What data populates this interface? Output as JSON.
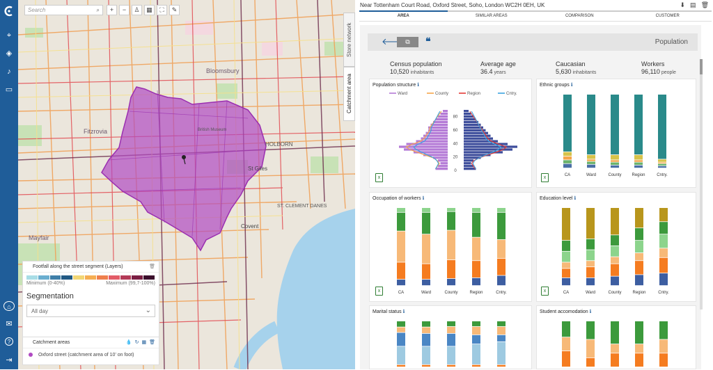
{
  "search": {
    "placeholder": "Search"
  },
  "map_labels": {
    "bloomsbury": "Bloomsbury",
    "fitzrovia": "Fitzrovia",
    "holborn": "HOLBORN",
    "st_giles": "St Giles",
    "british_museum": "British Museum",
    "clement_danes": "ST. CLEMENT DANES",
    "covent": "Covent",
    "mayfair": "Mayfair"
  },
  "side_tabs": {
    "store_network": "Store network",
    "catchment_area": "Catchment area"
  },
  "layers": {
    "title": "Footfall along the street segment (Layers)",
    "ramp_colors": [
      "#a8dde6",
      "#6aaecf",
      "#3f7fa8",
      "#225a84",
      "#f2d675",
      "#f5ae52",
      "#ef7f4d",
      "#e25c67",
      "#b33a57",
      "#7a1f43",
      "#3b0f2c"
    ],
    "min_label": "Minimum (0-40%)",
    "max_label": "Maximum (99,7-100%)"
  },
  "segmentation": {
    "title": "Segmentation",
    "value": "All day"
  },
  "catchment": {
    "title": "Catchment areas",
    "item": "Oxford street (catchment area of 10' on foot)"
  },
  "header": {
    "address": "Near Tottenham Court Road, Oxford Street, Soho, London WC2H 0EH, UK"
  },
  "tabs": [
    "AREA",
    "SIMILAR AREAS",
    "COMPARISON",
    "CUSTOMER"
  ],
  "section_title": "Population",
  "stats": [
    {
      "label": "Census population",
      "value": "10,520",
      "unit": "inhabitants"
    },
    {
      "label": "Average age",
      "value": "36.4",
      "unit": "years"
    },
    {
      "label": "Caucasian",
      "value": "5,630",
      "unit": "inhabitants"
    },
    {
      "label": "Workers",
      "value": "96,110",
      "unit": "people"
    }
  ],
  "cards": {
    "population_structure": "Population structure",
    "ethnic_groups": "Ethnic groups",
    "occupation": "Occupation of workers",
    "education": "Education level",
    "marital": "Marital status",
    "student": "Student accomodation"
  },
  "pyramid_legend": [
    "Ward",
    "County",
    "Region",
    "Cntry."
  ],
  "pyramid_legend_colors": [
    "#b47ad6",
    "#f5a54a",
    "#e53935",
    "#3aa3e0"
  ],
  "age_ticks": [
    "80",
    "60",
    "40",
    "20",
    "0"
  ],
  "bar_categories": [
    "CA",
    "Ward",
    "County",
    "Region",
    "Cntry."
  ],
  "colors": {
    "purple": "#a35bd3",
    "navy": "#3d4d9b",
    "teal": "#2b8c8c"
  },
  "chart_data": [
    {
      "type": "bar",
      "title": "Ethnic groups",
      "categories": [
        "CA",
        "Ward",
        "County",
        "Region",
        "Cntry."
      ],
      "series": [
        {
          "color": "#4a6fa5",
          "values": [
            6,
            5,
            4,
            4,
            3
          ]
        },
        {
          "color": "#6bb36b",
          "values": [
            5,
            4,
            4,
            4,
            3
          ]
        },
        {
          "color": "#f5a54a",
          "values": [
            5,
            3,
            3,
            3,
            2
          ]
        },
        {
          "color": "#d7c34a",
          "values": [
            6,
            6,
            7,
            7,
            4
          ]
        },
        {
          "color": "#2a8a8a",
          "values": [
            78,
            82,
            82,
            82,
            88
          ]
        }
      ]
    },
    {
      "type": "bar",
      "title": "Occupation of workers",
      "categories": [
        "CA",
        "Ward",
        "County",
        "Region",
        "Cntry."
      ],
      "series": [
        {
          "color": "#3d5ea1",
          "values": [
            8,
            8,
            9,
            10,
            13
          ]
        },
        {
          "color": "#f57c20",
          "values": [
            22,
            20,
            24,
            22,
            22
          ]
        },
        {
          "color": "#f7b978",
          "values": [
            40,
            38,
            38,
            30,
            24
          ]
        },
        {
          "color": "#3c9a3c",
          "values": [
            24,
            28,
            24,
            32,
            35
          ]
        },
        {
          "color": "#8cd48c",
          "values": [
            6,
            6,
            5,
            6,
            6
          ]
        }
      ]
    },
    {
      "type": "bar",
      "title": "Education level",
      "categories": [
        "CA",
        "Ward",
        "County",
        "Region",
        "Cntry."
      ],
      "series": [
        {
          "color": "#3d5ea1",
          "values": [
            10,
            10,
            12,
            14,
            16
          ]
        },
        {
          "color": "#f57c20",
          "values": [
            12,
            14,
            16,
            18,
            20
          ]
        },
        {
          "color": "#f7b978",
          "values": [
            8,
            8,
            9,
            10,
            12
          ]
        },
        {
          "color": "#8cd48c",
          "values": [
            14,
            14,
            14,
            16,
            18
          ]
        },
        {
          "color": "#3c9a3c",
          "values": [
            14,
            14,
            14,
            16,
            16
          ]
        },
        {
          "color": "#b8961c",
          "values": [
            42,
            40,
            35,
            26,
            18
          ]
        }
      ]
    },
    {
      "type": "bar",
      "title": "Marital status",
      "categories": [
        "CA",
        "Ward",
        "County",
        "Region",
        "Cntry."
      ],
      "series": [
        {
          "color": "#f57c20",
          "values": [
            5,
            5,
            5,
            5,
            5
          ]
        },
        {
          "color": "#9ecae1",
          "values": [
            40,
            40,
            40,
            45,
            50
          ]
        },
        {
          "color": "#4a86c4",
          "values": [
            30,
            28,
            28,
            20,
            15
          ]
        },
        {
          "color": "#f7b978",
          "values": [
            12,
            14,
            15,
            18,
            18
          ]
        },
        {
          "color": "#3c9a3c",
          "values": [
            13,
            13,
            12,
            12,
            12
          ]
        }
      ]
    },
    {
      "type": "bar",
      "title": "Student accomodation",
      "categories": [
        "CA",
        "Ward",
        "County",
        "Region",
        "Cntry."
      ],
      "series": [
        {
          "color": "#f57c20",
          "values": [
            35,
            20,
            30,
            30,
            30
          ]
        },
        {
          "color": "#f7b978",
          "values": [
            30,
            40,
            20,
            20,
            30
          ]
        },
        {
          "color": "#3c9a3c",
          "values": [
            35,
            40,
            50,
            50,
            40
          ]
        }
      ]
    },
    {
      "type": "bar",
      "title": "Population structure",
      "orientation": "horizontal",
      "y_ticks": [
        0,
        20,
        40,
        60,
        80
      ],
      "series": [
        {
          "name": "Ward",
          "color": "#b47ad6",
          "values": [
            5,
            4,
            3,
            4,
            6,
            10,
            14,
            18,
            20,
            17,
            13,
            11,
            10,
            9,
            8,
            8,
            7,
            6,
            5,
            4,
            3,
            2
          ]
        },
        {
          "color": "#3d4d9b",
          "values": [
            5,
            4,
            3,
            4,
            7,
            11,
            16,
            20,
            22,
            18,
            14,
            12,
            11,
            10,
            9,
            8,
            7,
            6,
            5,
            4,
            3,
            2
          ]
        }
      ]
    }
  ]
}
